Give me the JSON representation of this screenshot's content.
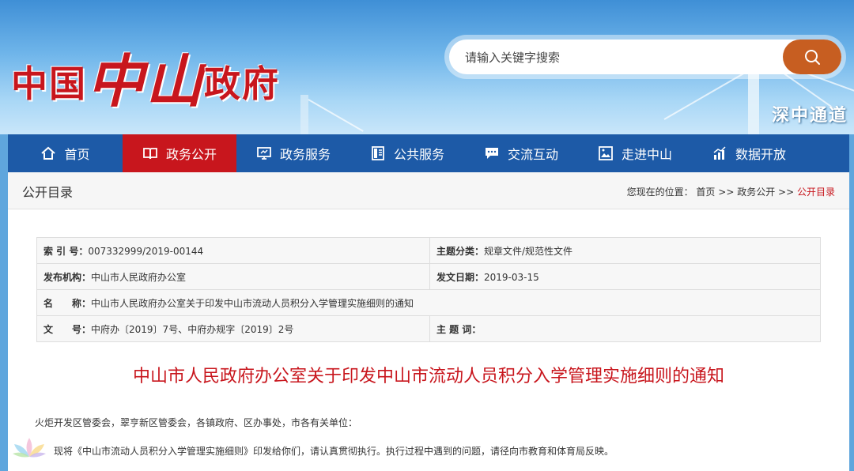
{
  "header": {
    "logo": {
      "part1": "中国",
      "part2": "中山",
      "part3": "政府"
    },
    "search": {
      "placeholder": "请输入关键字搜索",
      "button_icon": "search-icon"
    },
    "tagline": "深中通道"
  },
  "nav": {
    "items": [
      {
        "label": "首页",
        "icon": "home-icon"
      },
      {
        "label": "政务公开",
        "icon": "book-icon",
        "active": true
      },
      {
        "label": "政务服务",
        "icon": "monitor-icon"
      },
      {
        "label": "公共服务",
        "icon": "document-icon"
      },
      {
        "label": "交流互动",
        "icon": "chat-icon"
      },
      {
        "label": "走进中山",
        "icon": "picture-icon"
      },
      {
        "label": "数据开放",
        "icon": "chart-icon"
      }
    ]
  },
  "section": {
    "title": "公开目录",
    "breadcrumb": {
      "prefix": "您现在的位置：",
      "home": "首页",
      "sep": ">>",
      "level1": "政务公开",
      "current": "公开目录"
    }
  },
  "meta": {
    "index_label": "索 引 号：",
    "index_value": "007332999/2019-00144",
    "topic_label": "主题分类：",
    "topic_value": "规章文件/规范性文件",
    "org_label": "发布机构：",
    "org_value": "中山市人民政府办公室",
    "date_label": "发文日期：",
    "date_value": "2019-03-15",
    "name_label": "名　　称：",
    "name_value": "中山市人民政府办公室关于印发中山市流动人员积分入学管理实施细则的通知",
    "docno_label": "文　　号：",
    "docno_value": "中府办〔2019〕7号、中府办规字〔2019〕2号",
    "keywords_label": "主 题 词：",
    "keywords_value": ""
  },
  "document": {
    "title": "中山市人民政府办公室关于印发中山市流动人员积分入学管理实施细则的通知",
    "salutation": "火炬开发区管委会，翠亨新区管委会，各镇政府、区办事处，市各有关单位：",
    "body1": "现将《中山市流动人员积分入学管理实施细则》印发给你们，请认真贯彻执行。执行过程中遇到的问题，请径向市教育和体育局反映。"
  },
  "colors": {
    "brand_red": "#c8161d",
    "nav_blue": "#1d5aa7",
    "search_orange": "#c75e21"
  }
}
